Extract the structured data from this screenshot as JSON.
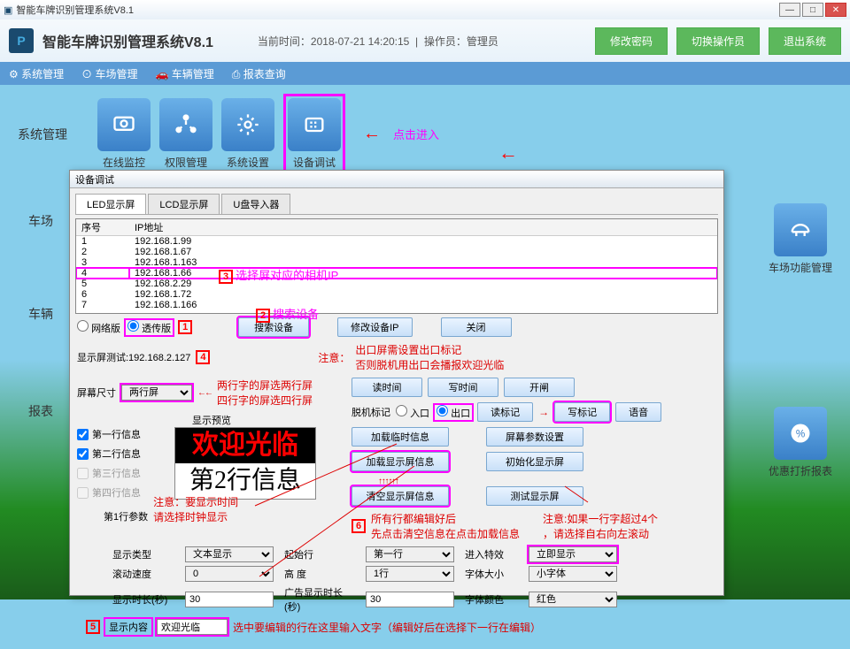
{
  "titlebar": "智能车牌识别管理系统V8.1",
  "header": {
    "title": "智能车牌识别管理系统V8.1",
    "time_label": "当前时间：2018-07-21 14:20:15",
    "operator_label": "操作员：管理员",
    "btn_change_pw": "修改密码",
    "btn_switch_op": "切换操作员",
    "btn_exit": "退出系统"
  },
  "menubar": {
    "m1": "系统管理",
    "m2": "车场管理",
    "m3": "车辆管理",
    "m4": "报表查询"
  },
  "toolbar": {
    "section1_label": "系统管理",
    "items": [
      {
        "label": "在线监控"
      },
      {
        "label": "权限管理"
      },
      {
        "label": "系统设置"
      },
      {
        "label": "设备调试"
      }
    ],
    "click_hint": "点击进入",
    "section2_label": "车场",
    "section3_label": "车辆",
    "section4_label": "报表",
    "right1": "车场功能管理",
    "right2": "优惠打折报表"
  },
  "dialog": {
    "title": "设备调试",
    "tabs": {
      "t1": "LED显示屏",
      "t2": "LCD显示屏",
      "t3": "U盘导入器"
    },
    "table": {
      "col1": "序号",
      "col2": "IP地址",
      "rows": [
        {
          "n": "1",
          "ip": "192.168.1.99"
        },
        {
          "n": "2",
          "ip": "192.168.1.67"
        },
        {
          "n": "3",
          "ip": "192.168.1.163"
        },
        {
          "n": "4",
          "ip": "192.168.1.66"
        },
        {
          "n": "5",
          "ip": "192.168.2.29"
        },
        {
          "n": "6",
          "ip": "192.168.1.72"
        },
        {
          "n": "7",
          "ip": "192.168.1.166"
        }
      ]
    },
    "annotation3": "选择屏对应的相机IP",
    "annotation2": "搜索设备",
    "radio_network": "网络版",
    "radio_transparent": "透传版",
    "btn_search": "搜索设备",
    "btn_modify_ip": "修改设备IP",
    "btn_close": "关闭",
    "test_label": "显示屏测试:192.168.2.127",
    "screen_size_label": "屏幕尺寸",
    "screen_size_value": "两行屏",
    "size_hint1": "两行字的屏选两行屏",
    "size_hint2": "四行字的屏选四行屏",
    "preview_label": "显示预览",
    "line1": "第一行信息",
    "line2": "第二行信息",
    "line3": "第三行信息",
    "line4": "第四行信息",
    "preview_text1": "欢迎光临",
    "preview_text2": "第2行信息",
    "param_label": "第1行参数",
    "param_hint1": "注意：要显示时间",
    "param_hint2": "请选择时钟显示",
    "display_type_label": "显示类型",
    "display_type_value": "文本显示",
    "scroll_speed_label": "滚动速度",
    "scroll_speed_value": "0",
    "display_duration_label": "显示时长(秒)",
    "display_duration_value": "30",
    "display_content_label": "显示内容",
    "display_content_value": "欢迎光临",
    "content_hint": "选中要编辑的行在这里输入文字（编辑好后在选择下一行在编辑）",
    "notice_label": "注意：",
    "notice1": "出口屏需设置出口标记",
    "notice2": "否则脱机用出口会播报欢迎光临",
    "offline_label": "脱机标记",
    "radio_in": "入口",
    "radio_out": "出口",
    "btn_read_mark": "读标记",
    "btn_write_mark": "写标记",
    "btn_voice": "语音",
    "btn_read_time": "读时间",
    "btn_write_time": "写时间",
    "btn_open_gate": "开闸",
    "btn_load_temp": "加载临时信息",
    "btn_screen_param": "屏幕参数设置",
    "btn_load_info": "加载显示屏信息",
    "btn_init_screen": "初始化显示屏",
    "btn_clear_info": "清空显示屏信息",
    "btn_test_screen": "测试显示屏",
    "hint6a": "所有行都编辑好后",
    "hint6b": "先点击清空信息在点击加载信息",
    "hint_right1": "注意:如果一行字超过4个",
    "hint_right2": "，请选择自右向左滚动",
    "start_line_label": "起始行",
    "start_line_value": "第一行",
    "enter_effect_label": "进入特效",
    "enter_effect_value": "立即显示",
    "height_label": "高 度",
    "height_value": "1行",
    "font_size_label": "字体大小",
    "font_size_value": "小字体",
    "ad_duration_label": "广告显示时长(秒)",
    "ad_duration_value": "30",
    "font_color_label": "字体颜色",
    "font_color_value": "红色"
  }
}
